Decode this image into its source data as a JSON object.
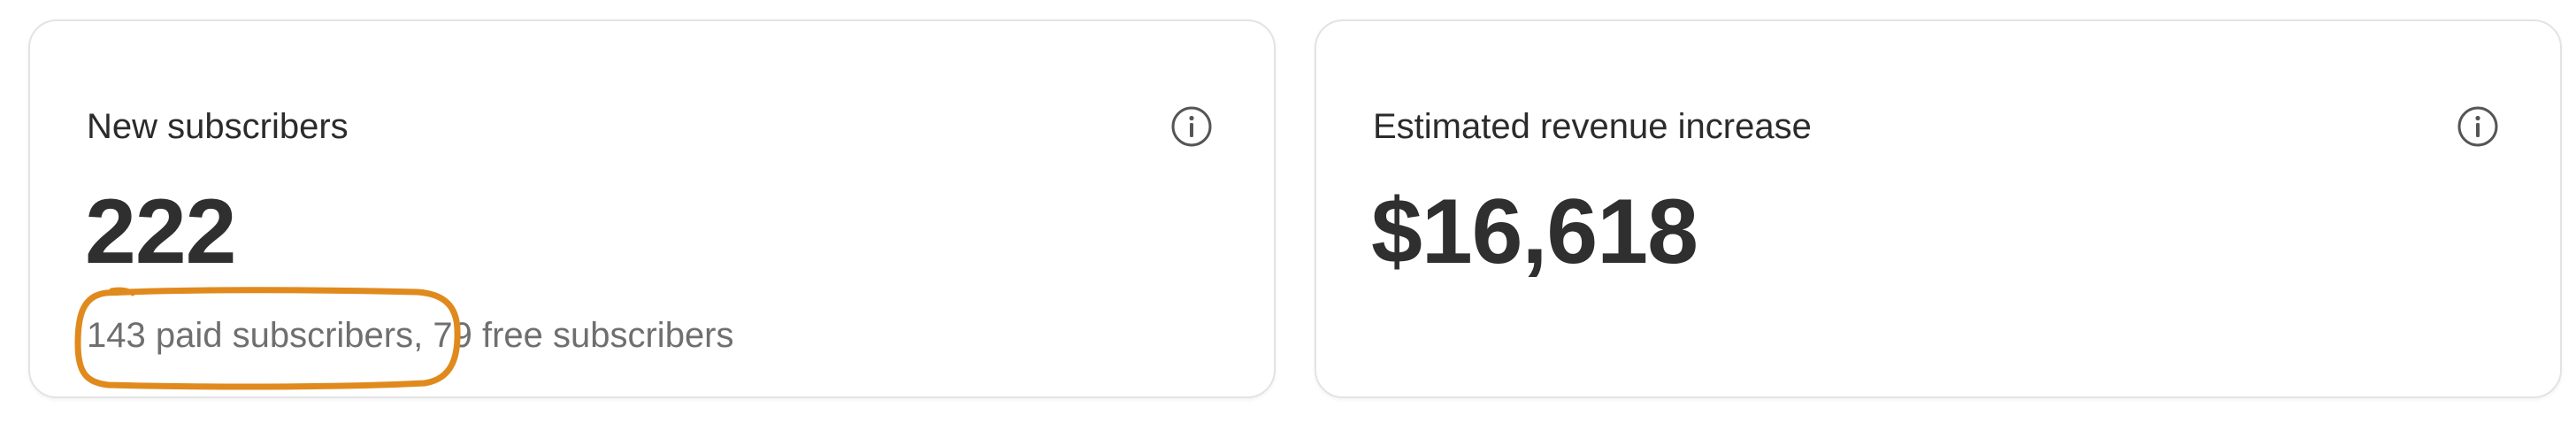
{
  "cards": [
    {
      "title": "New subscribers",
      "value": "222",
      "paid_text": "143 paid subscribers",
      "separator": ",",
      "free_text": " 79 free subscribers",
      "info_icon": "info-circle-icon"
    },
    {
      "title": "Estimated revenue increase",
      "value": "$16,618",
      "info_icon": "info-circle-icon"
    }
  ],
  "colors": {
    "annotation": "#e08a1e",
    "border": "#e3e3e3",
    "text_primary": "#2f2f2f",
    "text_secondary": "#6f6f6f"
  }
}
